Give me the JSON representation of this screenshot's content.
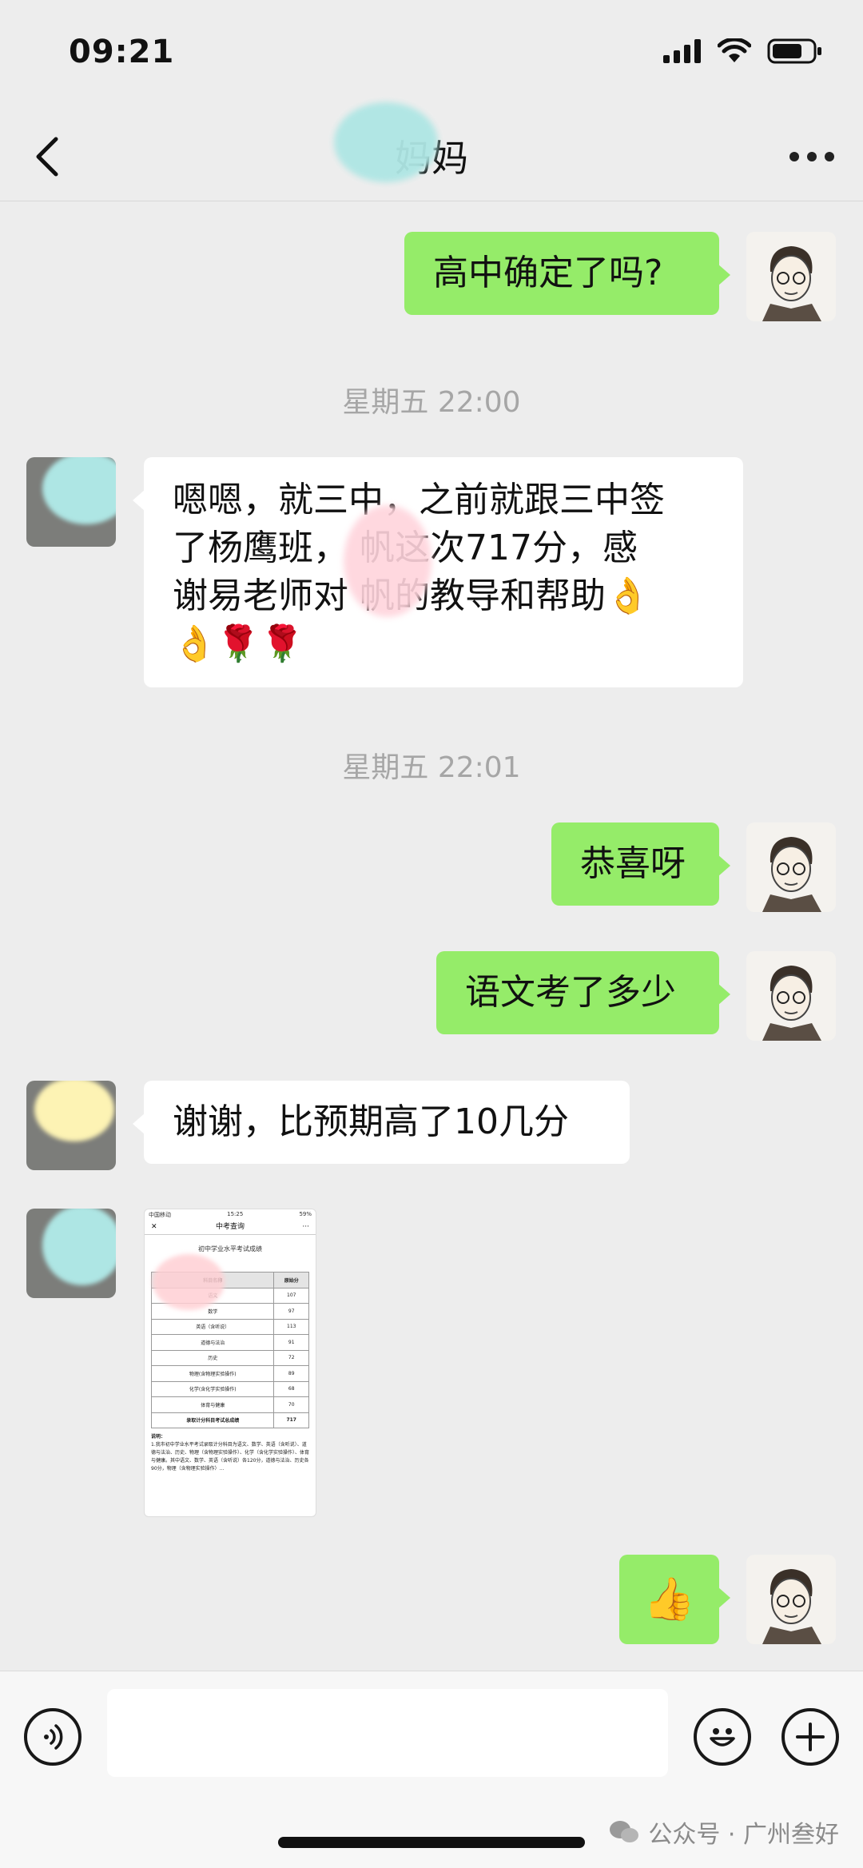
{
  "status_bar": {
    "time": "09:21"
  },
  "header": {
    "title": "妈妈"
  },
  "messages": {
    "m1": "高中确定了吗?",
    "ts1": "星期五 22:00",
    "m2_line1": "嗯嗯，就三中，之前就跟三中签",
    "m2_line2": "了杨鹰班，   帆这次717分，感",
    "m2_line3": "谢易老师对   帆的教导和帮助👌",
    "m2_line4": "👌🌹🌹",
    "ts2": "星期五 22:01",
    "m3": "恭喜呀",
    "m4": "语文考了多少",
    "m5": "谢谢，比预期高了10几分",
    "m6": "👍"
  },
  "image_message": {
    "carrier": "中国移动",
    "time": "15:25",
    "battery": "59%",
    "nav_title": "中考查询",
    "heading": "初中学业水平考试成绩",
    "col_subject": "科目名称",
    "col_score": "原始分",
    "rows": [
      {
        "subject": "语文",
        "score": "107"
      },
      {
        "subject": "数学",
        "score": "97"
      },
      {
        "subject": "英语（含听说）",
        "score": "113"
      },
      {
        "subject": "道德与法治",
        "score": "91"
      },
      {
        "subject": "历史",
        "score": "72"
      },
      {
        "subject": "物理(含物理实验操作)",
        "score": "89"
      },
      {
        "subject": "化学(含化学实验操作)",
        "score": "68"
      },
      {
        "subject": "体育与健康",
        "score": "70"
      },
      {
        "subject": "录取计分科目考试总成绩",
        "score": "717"
      }
    ],
    "notes_title": "说明：",
    "notes_text": "1.我市初中学业水平考试录取计分科目为语文、数学、英语（含听说）、道德与法治、历史、物理（含物理实验操作）、化学（含化学实验操作）、体育与健康。其中语文、数学、英语（含听说）各120分，道德与法治、历史各90分，物理（含物理实验操作）..."
  },
  "watermark": "公众号 · 广州叁好"
}
